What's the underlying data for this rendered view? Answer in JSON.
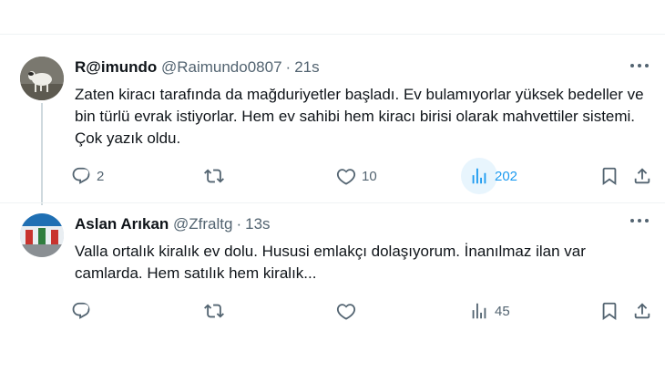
{
  "tweets": [
    {
      "name": "R@imundo",
      "handle": "@Raimundo0807",
      "dot": "·",
      "time": "21s",
      "text": "Zaten kiracı tarafında da mağduriyetler başladı. Ev bulamıyorlar yüksek bedeller ve bin türlü evrak istiyorlar. Hem ev sahibi hem kiracı birisi olarak mahvettiler sistemi. Çok yazık oldu.",
      "replies": "2",
      "reposts": "",
      "likes": "10",
      "views": "202"
    },
    {
      "name": "Aslan Arıkan",
      "handle": "@Zfraltg",
      "dot": "·",
      "time": "13s",
      "text": "Valla ortalık kiralık ev dolu. Hususi emlakçı dolaşıyorum. İnanılmaz ilan var camlarda. Hem satılık hem kiralık...",
      "replies": "",
      "reposts": "",
      "likes": "",
      "views": "45"
    }
  ],
  "colors": {
    "accent": "#1d9bf0",
    "secondary_text": "#536471",
    "primary_text": "#0f1419",
    "divider": "#eff3f4"
  },
  "icons": [
    "reply-icon",
    "repost-icon",
    "like-icon",
    "views-icon",
    "bookmark-icon",
    "share-icon",
    "more-icon"
  ]
}
